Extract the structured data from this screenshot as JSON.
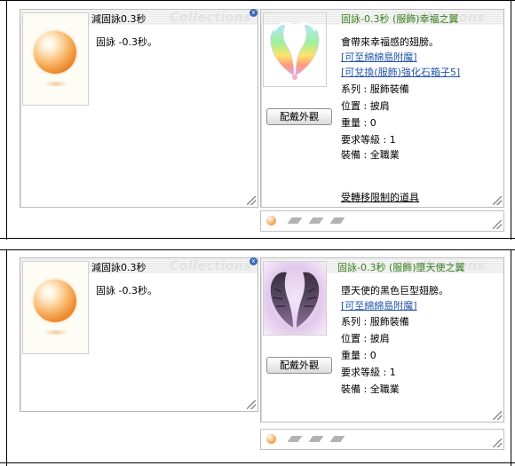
{
  "panels": [
    {
      "left_title": "減固詠0.3秒",
      "left_desc": "固詠 -0.3秒。",
      "right_title": "固詠-0.3秒 (服飾)幸福之翼",
      "equip_button": "配戴外觀",
      "watermark": "Collections",
      "lines": [
        {
          "text": "會帶來幸福感的翅膀。",
          "style": "plain"
        },
        {
          "text": "[可至綿綿島附魔]",
          "style": "link"
        },
        {
          "text": "[可兌換(服飾)強化石箱子5]",
          "style": "link"
        },
        {
          "text": "系列 : 服飾裝備",
          "style": "plain"
        },
        {
          "text": "位置 : 披肩",
          "style": "plain"
        },
        {
          "text": "重量 : 0",
          "style": "plain"
        },
        {
          "text": "要求等級 : 1",
          "style": "plain"
        },
        {
          "text": "裝備 : 全職業",
          "style": "plain"
        }
      ],
      "footer": "受轉移限制的道具",
      "wing_colors": [
        "#aee6f7",
        "#9ff09a",
        "#ffe46a",
        "#ff9a7d",
        "#d9a6f2"
      ]
    },
    {
      "left_title": "減固詠0.3秒",
      "left_desc": "固詠 -0.3秒。",
      "right_title": "固詠-0.3秒 (服飾)墮天使之翼",
      "equip_button": "配戴外觀",
      "watermark": "Collections",
      "lines": [
        {
          "text": "墮天使的黑色巨型翅膀。",
          "style": "plain"
        },
        {
          "text": "[可至綿綿島附魔]",
          "style": "link"
        },
        {
          "text": "系列 : 服飾裝備",
          "style": "plain"
        },
        {
          "text": "位置 : 披肩",
          "style": "plain"
        },
        {
          "text": "重量 : 0",
          "style": "plain"
        },
        {
          "text": "要求等級 : 1",
          "style": "plain"
        },
        {
          "text": "裝備 : 全職業",
          "style": "plain"
        }
      ],
      "footer": "",
      "wing_colors": [
        "#3a3040",
        "#5a4a66",
        "#8a6f9a",
        "#c7a6d6",
        "#e9d6f0"
      ]
    }
  ]
}
